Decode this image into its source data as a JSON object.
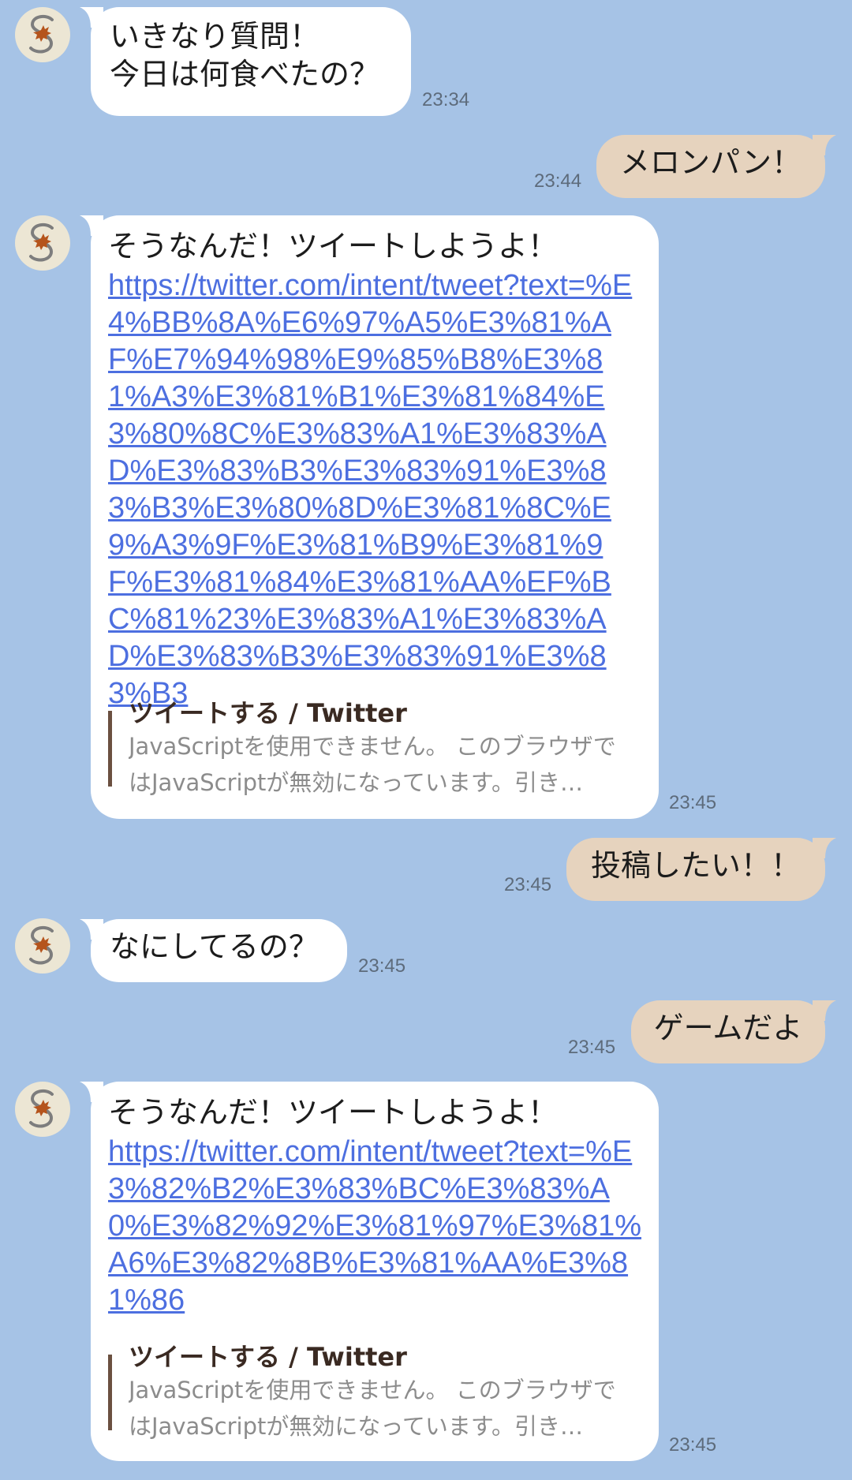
{
  "messages": [
    {
      "side": "in",
      "text": "いきなり質問！\n今日は何食べたの？",
      "time": "23:34"
    },
    {
      "side": "out",
      "text": "メロンパン！",
      "time": "23:44"
    },
    {
      "side": "in",
      "text": "そうなんだ！ツイートしようよ！",
      "link": "https://twitter.com/intent/tweet?text=%E4%BB%8A%E6%97%A5%E3%81%AF%E7%94%98%E9%85%B8%E3%81%A3%E3%81%B1%E3%81%84%E3%80%8C%E3%83%A1%E3%83%AD%E3%83%B3%E3%83%91%E3%83%B3%E3%80%8D%E3%81%8C%E9%A3%9F%E3%81%B9%E3%81%9F%E3%81%84%E3%81%AA%EF%BC%81%23%E3%83%A1%E3%83%AD%E3%83%B3%E3%83%91%E3%83%B3",
      "preview_title": "ツイートする / Twitter",
      "preview_desc": "JavaScriptを使用できません。 このブラウザではJavaScriptが無効になっています。引き…",
      "time": "23:45"
    },
    {
      "side": "out",
      "text": "投稿したい！！",
      "time": "23:45"
    },
    {
      "side": "in",
      "text": "なにしてるの？",
      "time": "23:45"
    },
    {
      "side": "out",
      "text": "ゲームだよ",
      "time": "23:45"
    },
    {
      "side": "in",
      "text": "そうなんだ！ツイートしようよ！",
      "link": "https://twitter.com/intent/tweet?text=%E3%82%B2%E3%83%BC%E3%83%A0%E3%82%92%E3%81%97%E3%81%A6%E3%82%8B%E3%81%AA%E3%81%86",
      "preview_title": "ツイートする / Twitter",
      "preview_desc": "JavaScriptを使用できません。 このブラウザではJavaScriptが無効になっています。引き…",
      "time": "23:45"
    }
  ]
}
